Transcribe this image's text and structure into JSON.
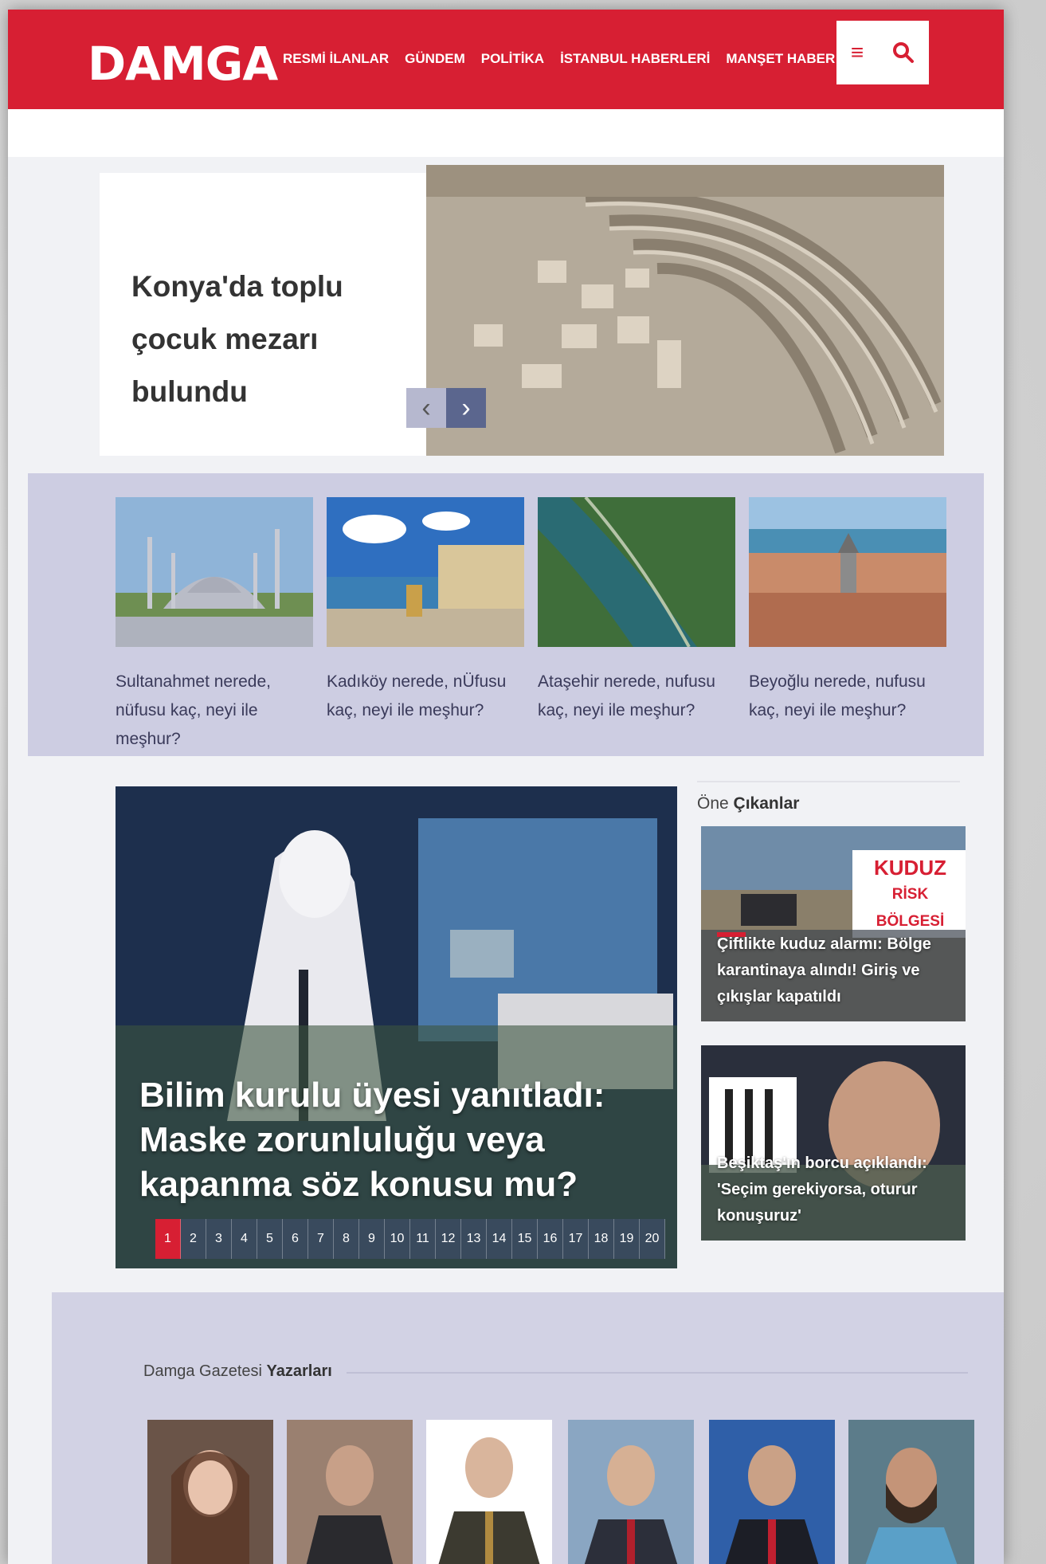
{
  "header": {
    "logo": "DAMGA",
    "nav": [
      "RESMİ İLANLAR",
      "GÜNDEM",
      "POLİTİKA",
      "İSTANBUL HABERLERİ",
      "MANŞET HABER"
    ],
    "menu_icon": "≡",
    "search_icon": "⚲"
  },
  "hero": {
    "title": "Konya'da toplu çocuk mezarı bulundu",
    "prev": "‹",
    "next": "›"
  },
  "districts": [
    {
      "caption": "Sultanahmet nerede, nüfusu kaç, neyi ile meşhur?"
    },
    {
      "caption": "Kadıköy nerede, nÜfusu kaç, neyi ile meşhur?"
    },
    {
      "caption": "Ataşehir nerede, nufusu kaç, neyi ile meşhur?"
    },
    {
      "caption": "Beyoğlu nerede, nufusu kaç, neyi ile meşhur?"
    }
  ],
  "main_news": {
    "title": "Bilim kurulu üyesi yanıtladı: Maske zorunluluğu veya kapanma söz konusu mu?",
    "pages": [
      "1",
      "2",
      "3",
      "4",
      "5",
      "6",
      "7",
      "8",
      "9",
      "10",
      "11",
      "12",
      "13",
      "14",
      "15",
      "16",
      "17",
      "18",
      "19",
      "20"
    ]
  },
  "featured": {
    "heading_light": "Öne",
    "heading_bold": "Çıkanlar",
    "items": [
      {
        "title": "Çiftlikte kuduz alarmı: Bölge karantinaya alındı! Giriş ve çıkışlar kapatıldı",
        "sign_line1": "KUDUZ",
        "sign_line2": "RİSK BÖLGESİ"
      },
      {
        "title": "Beşiktaş'ın borcu açıklandı: 'Seçim gerekiyorsa, oturur konuşuruz'"
      }
    ]
  },
  "writers": {
    "heading_light": "Damga Gazetesi",
    "heading_bold": "Yazarları",
    "count": 6
  }
}
